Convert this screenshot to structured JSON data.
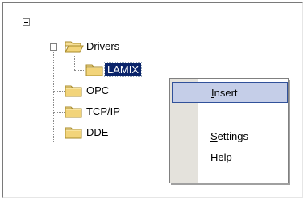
{
  "tree": {
    "root_toggle": "minus",
    "drivers": {
      "label": "Drivers",
      "expanded": true
    },
    "lamix": {
      "label": "LAMIX",
      "selected": true
    },
    "opc": {
      "label": "OPC"
    },
    "tcpip": {
      "label": "TCP/IP"
    },
    "dde": {
      "label": "DDE"
    }
  },
  "context_menu": {
    "insert": {
      "access_key": "I",
      "rest": "nsert",
      "highlighted": true
    },
    "settings": {
      "access_key": "S",
      "rest": "ettings"
    },
    "help": {
      "access_key": "H",
      "rest": "elp"
    }
  },
  "colors": {
    "selection": "#0a246a",
    "menu_highlight": "#c5cee8",
    "menu_highlight_border": "#31519a",
    "menu_gutter": "#e4e2dc",
    "folder": "#f0d878"
  }
}
